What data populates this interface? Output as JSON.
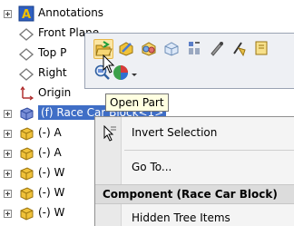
{
  "feature_tree": {
    "items": [
      {
        "label": "Annotations",
        "icon": "annotations-icon",
        "expandable": true
      },
      {
        "label": "Front Plane",
        "icon": "plane-icon",
        "expandable": false
      },
      {
        "label": "Top P",
        "icon": "plane-icon",
        "expandable": false
      },
      {
        "label": "Right",
        "icon": "plane-icon",
        "expandable": false
      },
      {
        "label": "Origin",
        "icon": "origin-icon",
        "expandable": false
      },
      {
        "label": "(f) Race Car Block<1>",
        "icon": "part-icon",
        "expandable": true,
        "selected": true
      },
      {
        "label": "(-) A",
        "icon": "part-icon",
        "expandable": true
      },
      {
        "label": "(-) A",
        "icon": "part-icon",
        "expandable": true
      },
      {
        "label": "(-) W",
        "icon": "part-icon",
        "expandable": true
      },
      {
        "label": "(-) W",
        "icon": "part-icon",
        "expandable": true
      },
      {
        "label": "(-) W",
        "icon": "part-icon",
        "expandable": true
      }
    ]
  },
  "context_toolbar": {
    "buttons": [
      {
        "name": "open-part-icon",
        "hot": true
      },
      {
        "name": "edit-part-icon"
      },
      {
        "name": "make-transparent-icon"
      },
      {
        "name": "change-transparency-icon"
      },
      {
        "name": "mate-icon"
      },
      {
        "name": "smart-fastener-icon"
      },
      {
        "name": "component-properties-icon"
      },
      {
        "name": "extra-toolbar-icon"
      }
    ],
    "row2": [
      {
        "name": "zoom-to-selection-icon"
      },
      {
        "name": "appearance-icon"
      },
      {
        "name": "dropdown-arrow-icon"
      }
    ]
  },
  "tooltip": {
    "text": "Open Part"
  },
  "context_menu": {
    "items": [
      {
        "label": "Invert Selection",
        "icon": "invert-selection-icon"
      },
      {
        "label": "Go To..."
      }
    ],
    "section_header": "Component (Race Car Block)",
    "section_items": [
      {
        "label": "Hidden Tree Items"
      }
    ]
  }
}
